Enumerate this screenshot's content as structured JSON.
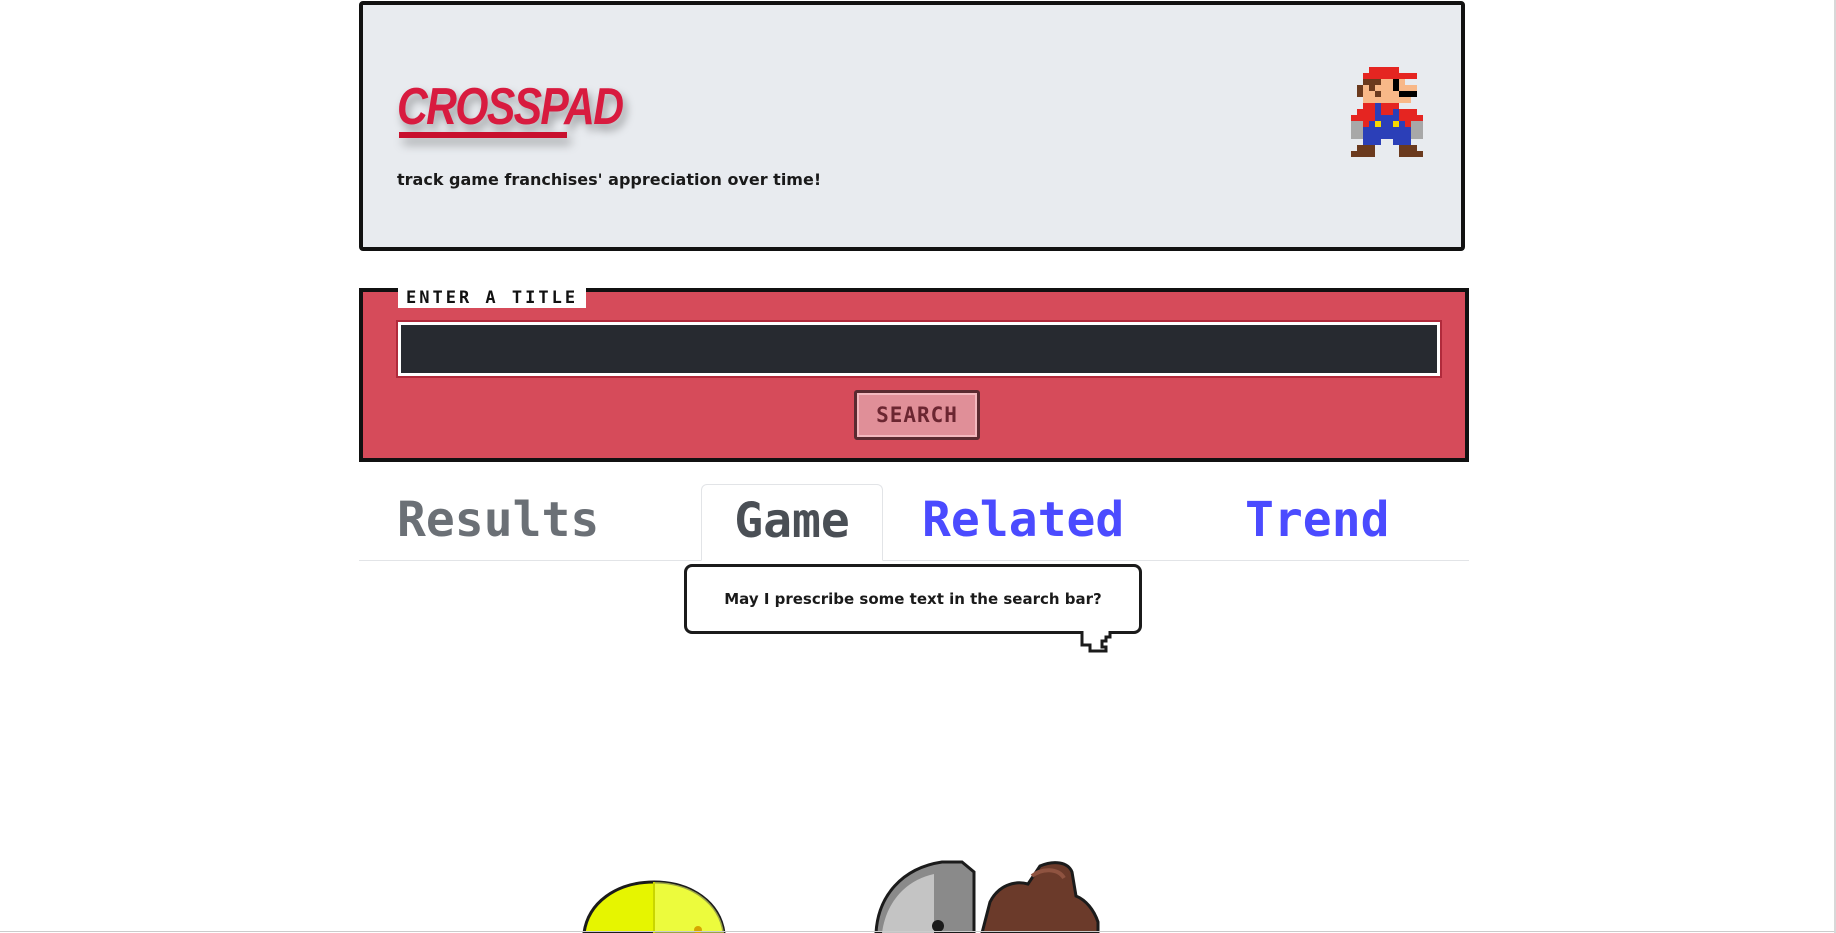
{
  "header": {
    "logo_text": "CROSSPAD",
    "tagline": "track game franchises' appreciation over time!",
    "mascot_icon": "mario-sprite-icon"
  },
  "search": {
    "legend": "ENTER A TITLE",
    "input_value": "",
    "placeholder": "",
    "button_label": "SEARCH"
  },
  "tabs": [
    {
      "label": "Results",
      "active": false
    },
    {
      "label": "Game",
      "active": true
    },
    {
      "label": "Related",
      "active": false
    },
    {
      "label": "Trend",
      "active": false
    }
  ],
  "bubble": {
    "text": "May I prescribe some text in the search bar?"
  },
  "colors": {
    "header_bg": "#e8ebef",
    "logo_red": "#d81b3f",
    "search_panel": "#d64b5a",
    "input_bg": "#272a30",
    "tab_link": "#4b4bff",
    "tab_inactive_gray": "#6b7076"
  }
}
